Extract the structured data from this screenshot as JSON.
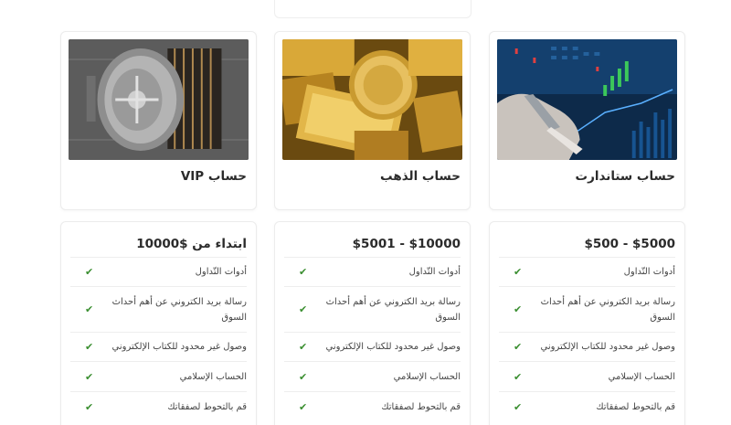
{
  "accounts": [
    {
      "title": "حساب ستاندارت",
      "price": "$500 - $5000",
      "features": [
        "أدوات التّداول",
        "رسالة بريد الكتروني عن أهم أحداث السوق",
        "وصول غير محدود للكتاب الإلكتروني",
        "الحساب الإسلامي",
        "قم بالتحوط لصفقاتك"
      ],
      "icons": {
        "image": "trading-chart-image",
        "check": "check-icon"
      }
    },
    {
      "title": "حساب الذهب",
      "price": "$5001 - $10000",
      "features": [
        "أدوات التّداول",
        "رسالة بريد الكتروني عن أهم أحداث السوق",
        "وصول غير محدود للكتاب الإلكتروني",
        "الحساب الإسلامي",
        "قم بالتحوط لصفقاتك"
      ],
      "icons": {
        "image": "gold-bars-image",
        "check": "check-icon"
      }
    },
    {
      "title": "حساب VIP",
      "price": "ابتداء من $10000",
      "features": [
        "أدوات التّداول",
        "رسالة بريد الكتروني عن أهم أحداث السوق",
        "وصول غير محدود للكتاب الإلكتروني",
        "الحساب الإسلامي",
        "قم بالتحوط لصفقاتك"
      ],
      "icons": {
        "image": "vault-door-image",
        "check": "check-icon"
      }
    }
  ],
  "colors": {
    "check": "#3a8e30",
    "border": "#ececec",
    "text": "#2b2b2b"
  }
}
